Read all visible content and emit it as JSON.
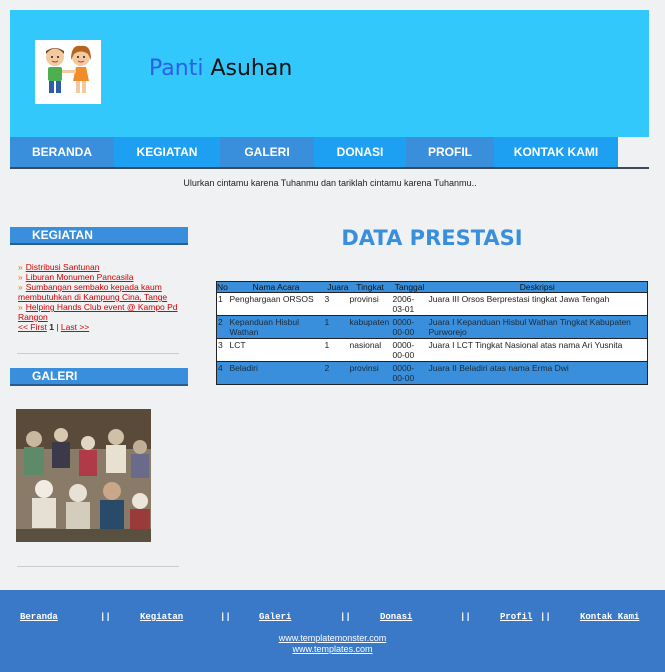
{
  "header": {
    "title_part1": "Panti",
    "title_part2": "Asuhan",
    "colors": {
      "bg": "#33c8fb",
      "title_part1": "#2b5fe6"
    }
  },
  "nav": [
    "BERANDA",
    "KEGIATAN",
    "GALERI",
    "DONASI",
    "PROFIL",
    "KONTAK KAMI"
  ],
  "tagline": "Ulurkan cintamu karena Tuhanmu dan tariklah cintamu karena Tuhanmu..",
  "sidebar": {
    "kegiatan_heading": "KEGIATAN",
    "kegiatan_items": [
      "Distribusi Santunan",
      "Liburan Monumen Pancasila",
      "Sumbangan sembako kepada kaum membutuhkan di Kampung Cina, Tange",
      "Helping Hands Club event @ Kampo Pd Rangon"
    ],
    "pager": {
      "first": "<< First",
      "current": "1",
      "separator": "|",
      "last": "Last >>"
    },
    "galeri_heading": "GALERI"
  },
  "main": {
    "title": "DATA PRESTASI",
    "table": {
      "headers": [
        "No",
        "Nama Acara",
        "Juara",
        "Tingkat",
        "Tanggal",
        "Deskripsi"
      ],
      "rows": [
        [
          "1",
          "Penghargaan ORSOS",
          "3",
          "provinsi",
          "2006-03-01",
          "Juara III Orsos Berprestasi tingkat Jawa Tengah"
        ],
        [
          "2",
          "Kepanduan Hisbul Wathan",
          "1",
          "kabupaten",
          "0000-00-00",
          "Juara I Kepanduan Hisbul Wathan Tingkat Kabupaten Purworejo"
        ],
        [
          "3",
          "LCT",
          "1",
          "nasional",
          "0000-00-00",
          "Juara I LCT Tingkat Nasional atas nama Ari Yusnita"
        ],
        [
          "4",
          "Beladiri",
          "2",
          "provinsi",
          "0000-00-00",
          "Juara II Beladiri atas nama Erma Dwi"
        ]
      ]
    }
  },
  "footer": {
    "links": [
      "Beranda",
      "Kegiatan",
      "Galeri",
      "Donasi",
      "Profil",
      "Kontak Kami"
    ],
    "separator": "||",
    "urls": [
      "www.templatemonster.com",
      "www.templates.com"
    ]
  },
  "icons": {
    "logo": "children-logo-icon",
    "photo": "galeri-photo"
  }
}
